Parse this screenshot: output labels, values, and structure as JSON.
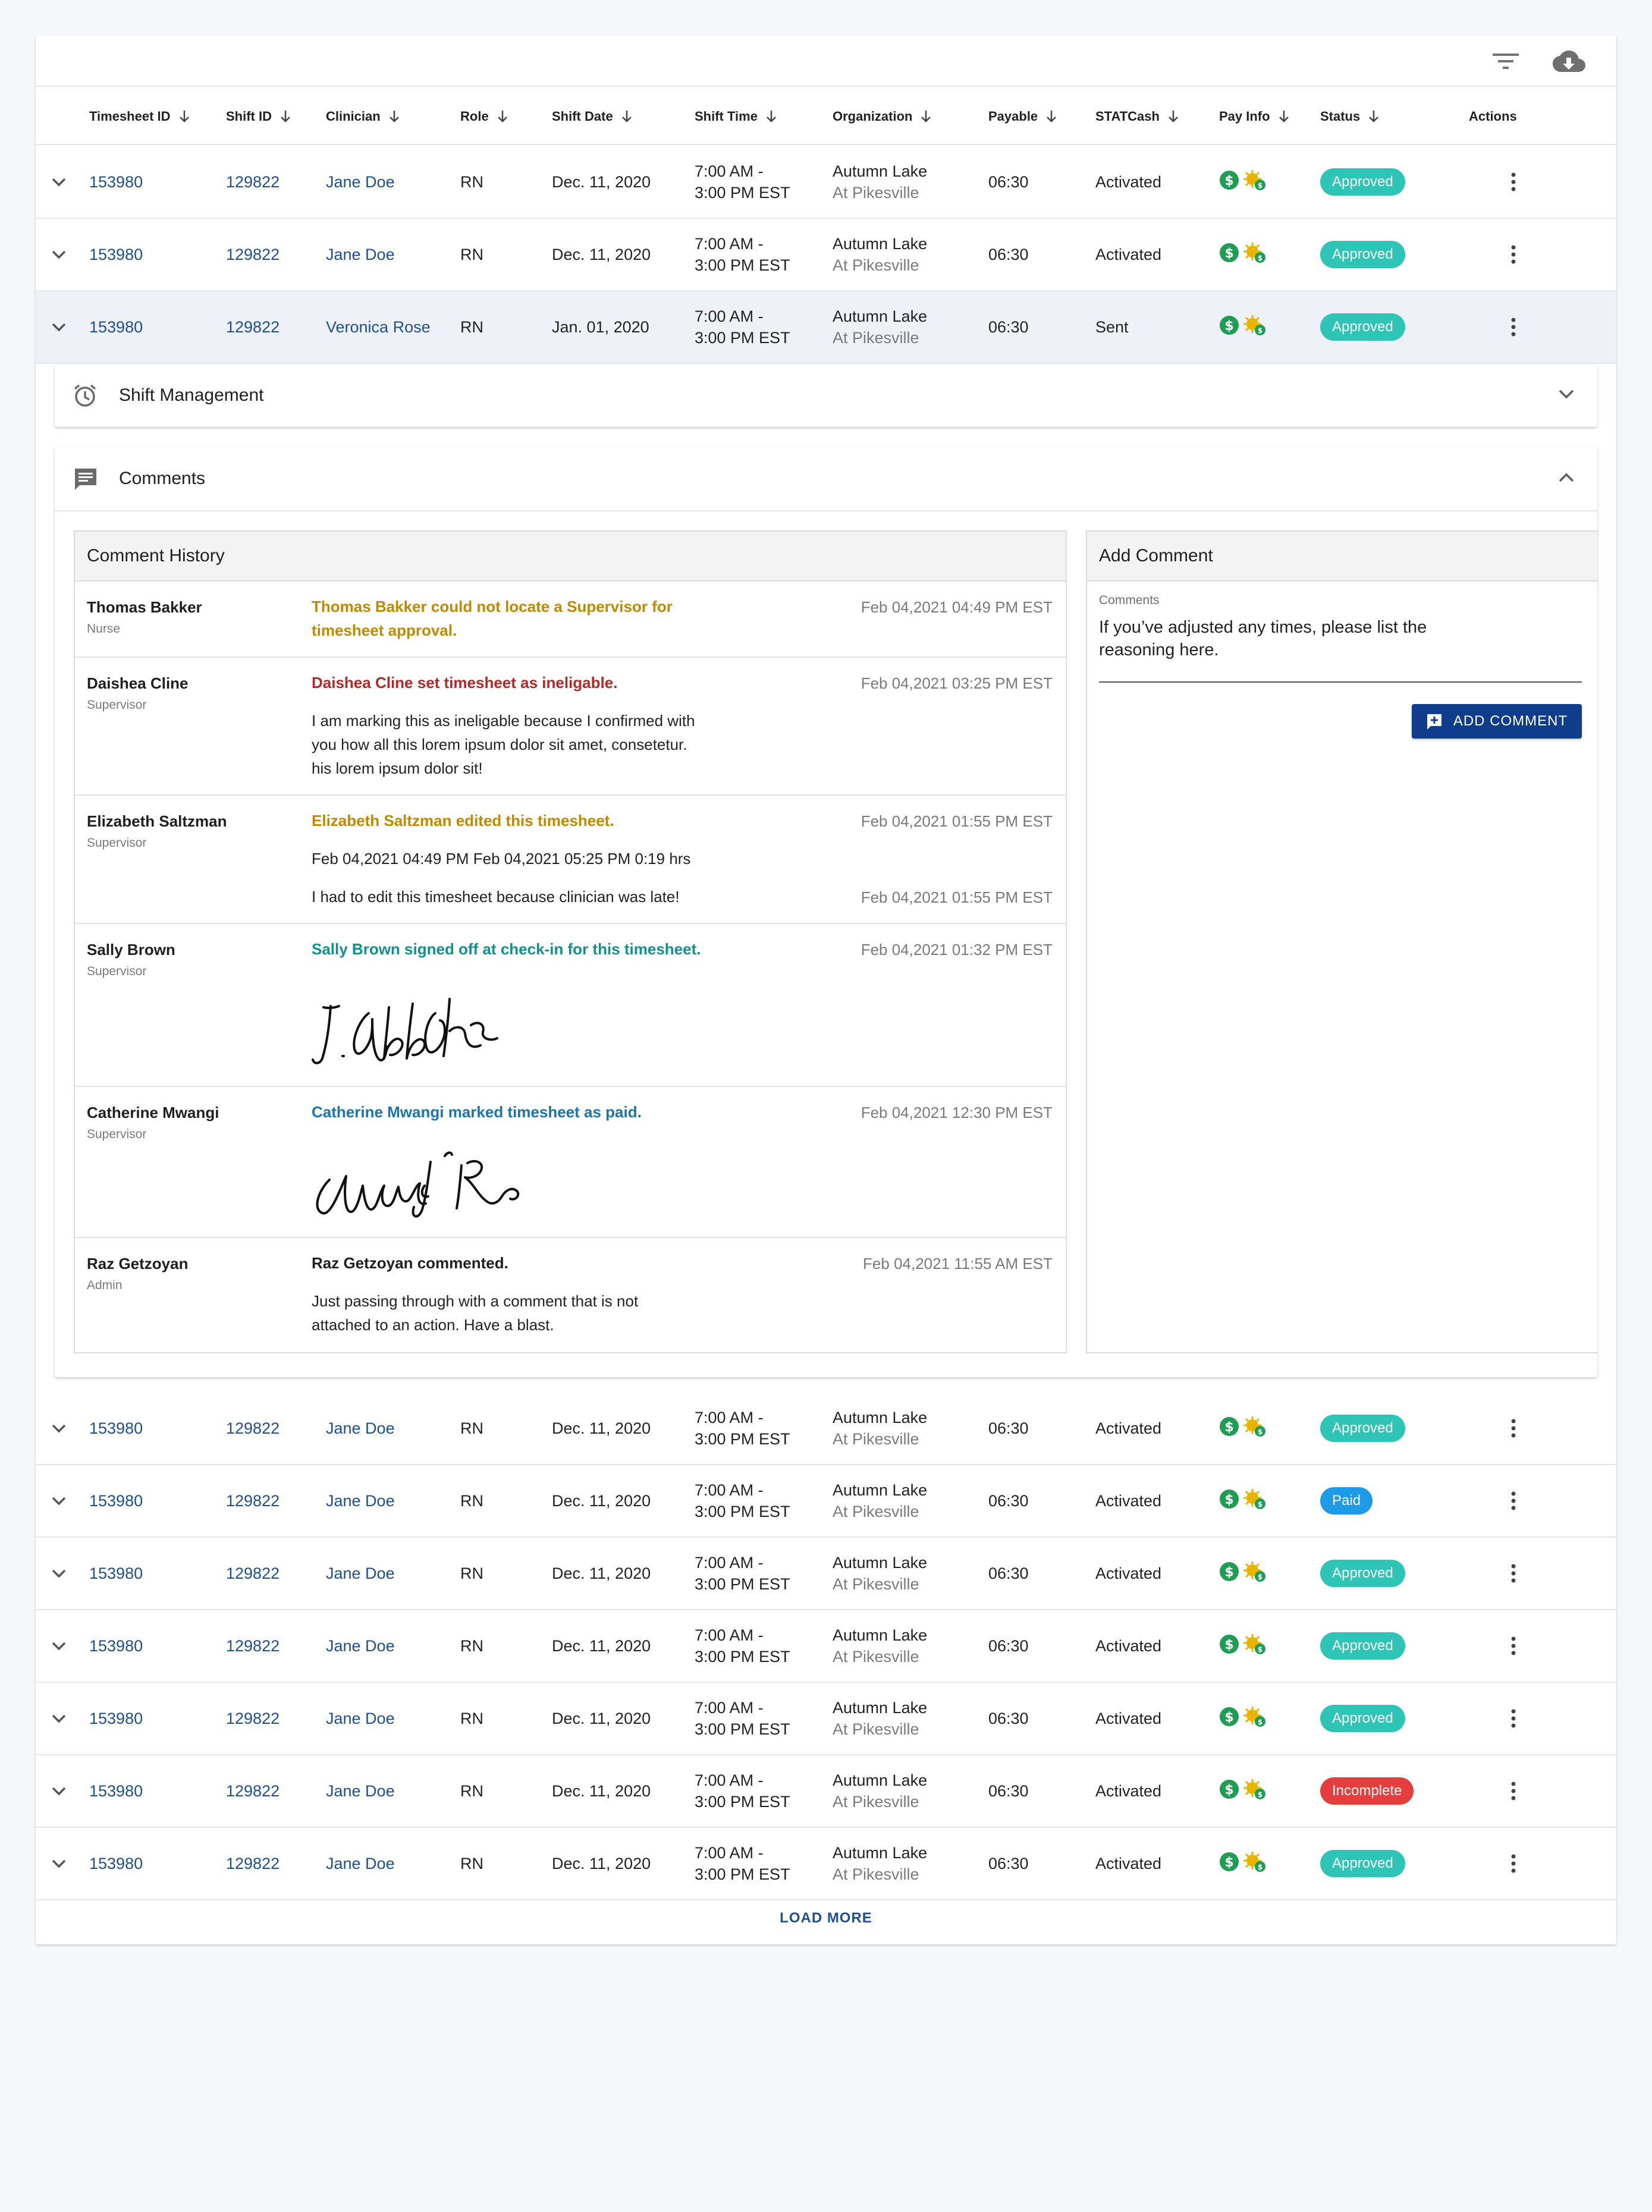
{
  "columns": [
    "Timesheet ID",
    "Shift ID",
    "Clinician",
    "Role",
    "Shift Date",
    "Shift Time",
    "Organization",
    "Payable",
    "STATCash",
    "Pay Info",
    "Status",
    "Actions"
  ],
  "rows_top": [
    {
      "timesheet_id": "153980",
      "shift_id": "129822",
      "clinician": "Jane Doe",
      "role": "RN",
      "shift_date": "Dec. 11, 2020",
      "time_line1": "7:00 AM -",
      "time_line2": "3:00 PM EST",
      "org_line1": "Autumn Lake",
      "org_line2": "At Pikesville",
      "payable": "06:30",
      "statcash": "Activated",
      "status": "Approved",
      "status_color": "#2ec4b6"
    },
    {
      "timesheet_id": "153980",
      "shift_id": "129822",
      "clinician": "Jane Doe",
      "role": "RN",
      "shift_date": "Dec. 11, 2020",
      "time_line1": "7:00 AM -",
      "time_line2": "3:00 PM EST",
      "org_line1": "Autumn Lake",
      "org_line2": "At Pikesville",
      "payable": "06:30",
      "statcash": "Activated",
      "status": "Approved",
      "status_color": "#2ec4b6"
    },
    {
      "timesheet_id": "153980",
      "shift_id": "129822",
      "clinician": "Veronica Rose",
      "role": "RN",
      "shift_date": "Jan. 01, 2020",
      "time_line1": "7:00 AM -",
      "time_line2": "3:00 PM EST",
      "org_line1": "Autumn Lake",
      "org_line2": "At Pikesville",
      "payable": "06:30",
      "statcash": "Sent",
      "status": "Approved",
      "status_color": "#2ec4b6"
    }
  ],
  "shift_management": {
    "title": "Shift Management"
  },
  "comments_panel": {
    "title": "Comments",
    "history_title": "Comment History",
    "items": [
      {
        "name": "Thomas Bakker",
        "role": "Nurse",
        "action_line1": "Thomas Bakker could not locate a Supervisor for",
        "action_line2": "timesheet approval.",
        "action_color": "#c08a00",
        "time": "Feb 04,2021 04:49 PM EST"
      },
      {
        "name": "Daishea Cline",
        "role": "Supervisor",
        "action_line1": "Daishea Cline set timesheet as ineligable.",
        "action_color": "#b02a2a",
        "text1": "I am marking this as ineligable because I confirmed with",
        "text2": "you how all this lorem ipsum dolor sit amet, consetetur.",
        "text3": "his lorem ipsum dolor sit!",
        "time": "Feb 04,2021 03:25 PM EST"
      },
      {
        "name": "Elizabeth Saltzman",
        "role": "Supervisor",
        "action_line1": "Elizabeth Saltzman edited this timesheet.",
        "action_color": "#c08a00",
        "text1": "Feb 04,2021 04:49 PM Feb 04,2021 05:25 PM  0:19 hrs",
        "text2": "I had to edit this timesheet because clinician was late!",
        "time": "Feb 04,2021 01:55 PM EST",
        "time2": "Feb 04,2021 01:55 PM EST"
      },
      {
        "name": "Sally Brown",
        "role": "Supervisor",
        "action_line1": "Sally Brown signed off at check-in for this timesheet.",
        "action_color": "#13908a",
        "signature": "I. Golbb Rn",
        "time": "Feb 04,2021 01:32 PM EST"
      },
      {
        "name": "Catherine Mwangi",
        "role": "Supervisor",
        "action_line1": "Catherine Mwangi marked timesheet as paid.",
        "action_color": "#1a75b0",
        "signature": "Mwangi Rn",
        "time": "Feb 04,2021 12:30 PM EST"
      },
      {
        "name": "Raz Getzoyan",
        "role": "Admin",
        "action_line1": "Raz Getzoyan commented.",
        "action_color": "#1f1f1f",
        "text1": "Just passing through with a comment that is not",
        "text2": "attached to an action. Have a blast.",
        "time": "Feb 04,2021 11:55 AM EST"
      }
    ],
    "add_title": "Add Comment",
    "field_label": "Comments",
    "field_line1": "If you’ve adjusted any times, please list the",
    "field_line2": "reasoning here.",
    "add_button": "ADD COMMENT"
  },
  "rows_bottom": [
    {
      "timesheet_id": "153980",
      "shift_id": "129822",
      "clinician": "Jane Doe",
      "role": "RN",
      "shift_date": "Dec. 11, 2020",
      "time_line1": "7:00 AM -",
      "time_line2": "3:00 PM EST",
      "org_line1": "Autumn Lake",
      "org_line2": "At Pikesville",
      "payable": "06:30",
      "statcash": "Activated",
      "status": "Approved",
      "status_color": "#2ec4b6"
    },
    {
      "timesheet_id": "153980",
      "shift_id": "129822",
      "clinician": "Jane Doe",
      "role": "RN",
      "shift_date": "Dec. 11, 2020",
      "time_line1": "7:00 AM -",
      "time_line2": "3:00 PM EST",
      "org_line1": "Autumn Lake",
      "org_line2": "At Pikesville",
      "payable": "06:30",
      "statcash": "Activated",
      "status": "Paid",
      "status_color": "#1e9be6"
    },
    {
      "timesheet_id": "153980",
      "shift_id": "129822",
      "clinician": "Jane Doe",
      "role": "RN",
      "shift_date": "Dec. 11, 2020",
      "time_line1": "7:00 AM -",
      "time_line2": "3:00 PM EST",
      "org_line1": "Autumn Lake",
      "org_line2": "At Pikesville",
      "payable": "06:30",
      "statcash": "Activated",
      "status": "Approved",
      "status_color": "#2ec4b6"
    },
    {
      "timesheet_id": "153980",
      "shift_id": "129822",
      "clinician": "Jane Doe",
      "role": "RN",
      "shift_date": "Dec. 11, 2020",
      "time_line1": "7:00 AM -",
      "time_line2": "3:00 PM EST",
      "org_line1": "Autumn Lake",
      "org_line2": "At Pikesville",
      "payable": "06:30",
      "statcash": "Activated",
      "status": "Approved",
      "status_color": "#2ec4b6"
    },
    {
      "timesheet_id": "153980",
      "shift_id": "129822",
      "clinician": "Jane Doe",
      "role": "RN",
      "shift_date": "Dec. 11, 2020",
      "time_line1": "7:00 AM -",
      "time_line2": "3:00 PM EST",
      "org_line1": "Autumn Lake",
      "org_line2": "At Pikesville",
      "payable": "06:30",
      "statcash": "Activated",
      "status": "Approved",
      "status_color": "#2ec4b6"
    },
    {
      "timesheet_id": "153980",
      "shift_id": "129822",
      "clinician": "Jane Doe",
      "role": "RN",
      "shift_date": "Dec. 11, 2020",
      "time_line1": "7:00 AM -",
      "time_line2": "3:00 PM EST",
      "org_line1": "Autumn Lake",
      "org_line2": "At Pikesville",
      "payable": "06:30",
      "statcash": "Activated",
      "status": "Incomplete",
      "status_color": "#e53e3e"
    },
    {
      "timesheet_id": "153980",
      "shift_id": "129822",
      "clinician": "Jane Doe",
      "role": "RN",
      "shift_date": "Dec. 11, 2020",
      "time_line1": "7:00 AM -",
      "time_line2": "3:00 PM EST",
      "org_line1": "Autumn Lake",
      "org_line2": "At Pikesville",
      "payable": "06:30",
      "statcash": "Activated",
      "status": "Approved",
      "status_color": "#2ec4b6"
    }
  ],
  "load_more": "LOAD MORE",
  "icons": {
    "filter": "filter-icon",
    "download": "cloud-download-icon",
    "expand": "chevron-down-icon",
    "more": "more-vert-icon",
    "pay": "dollar-circle-icon",
    "statcash": "statcash-icon",
    "alarm": "alarm-clock-icon",
    "comment": "comment-icon"
  }
}
